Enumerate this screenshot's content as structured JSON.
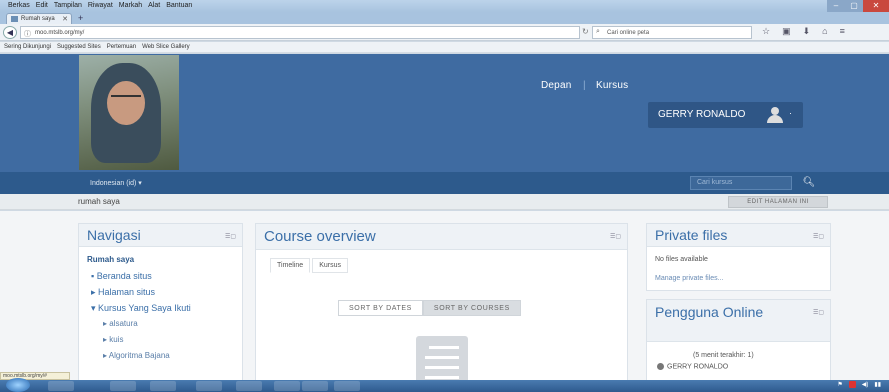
{
  "browser": {
    "menu": [
      "Berkas",
      "Edit",
      "Tampilan",
      "Riwayat",
      "Markah",
      "Alat",
      "Bantuan"
    ],
    "tab_title": "Rumah saya",
    "url": "moo.mtslb.org/my/",
    "search_placeholder": "Cari online peta",
    "bookmarks": [
      "Sering Dikunjungi",
      "Suggested Sites",
      "Pertemuan",
      "Web Slice Gallery"
    ]
  },
  "header": {
    "nav": [
      "Depan",
      "Kursus"
    ],
    "user_name": "GERRY RONALDO",
    "language": "Indonesian (id) ▾",
    "search_placeholder": "Cari kursus"
  },
  "breadcrumb": "rumah saya",
  "edit_button": "EDIT HALAMAN INI",
  "navigasi": {
    "title": "Navigasi",
    "items": [
      {
        "label": "Rumah saya",
        "level": "bold"
      },
      {
        "label": "▪  Beranda situs",
        "level": "i1"
      },
      {
        "label": "▸ Halaman situs",
        "level": "i1"
      },
      {
        "label": "▾ Kursus Yang Saya Ikuti",
        "level": "i1"
      },
      {
        "label": "▸ alsatura",
        "level": "i2"
      },
      {
        "label": "▸ kuis",
        "level": "i2"
      },
      {
        "label": "▸ Algoritma Bajana",
        "level": "i2"
      }
    ]
  },
  "course_overview": {
    "title": "Course overview",
    "tabs": [
      "Timeline",
      "Kursus"
    ],
    "sort_dates": "SORT BY DATES",
    "sort_courses": "SORT BY COURSES"
  },
  "private_files": {
    "title": "Private files",
    "empty": "No files available",
    "manage": "Manage private files..."
  },
  "online_users": {
    "title": "Pengguna Online",
    "info": "(5 menit terakhir: 1)",
    "user": "GERRY RONALDO"
  },
  "status_url": "moo.mtslb.org/my/#",
  "colors": {
    "header": "#3f6ba1",
    "subbar": "#2d5a8c",
    "accent": "#3b6fa8"
  }
}
